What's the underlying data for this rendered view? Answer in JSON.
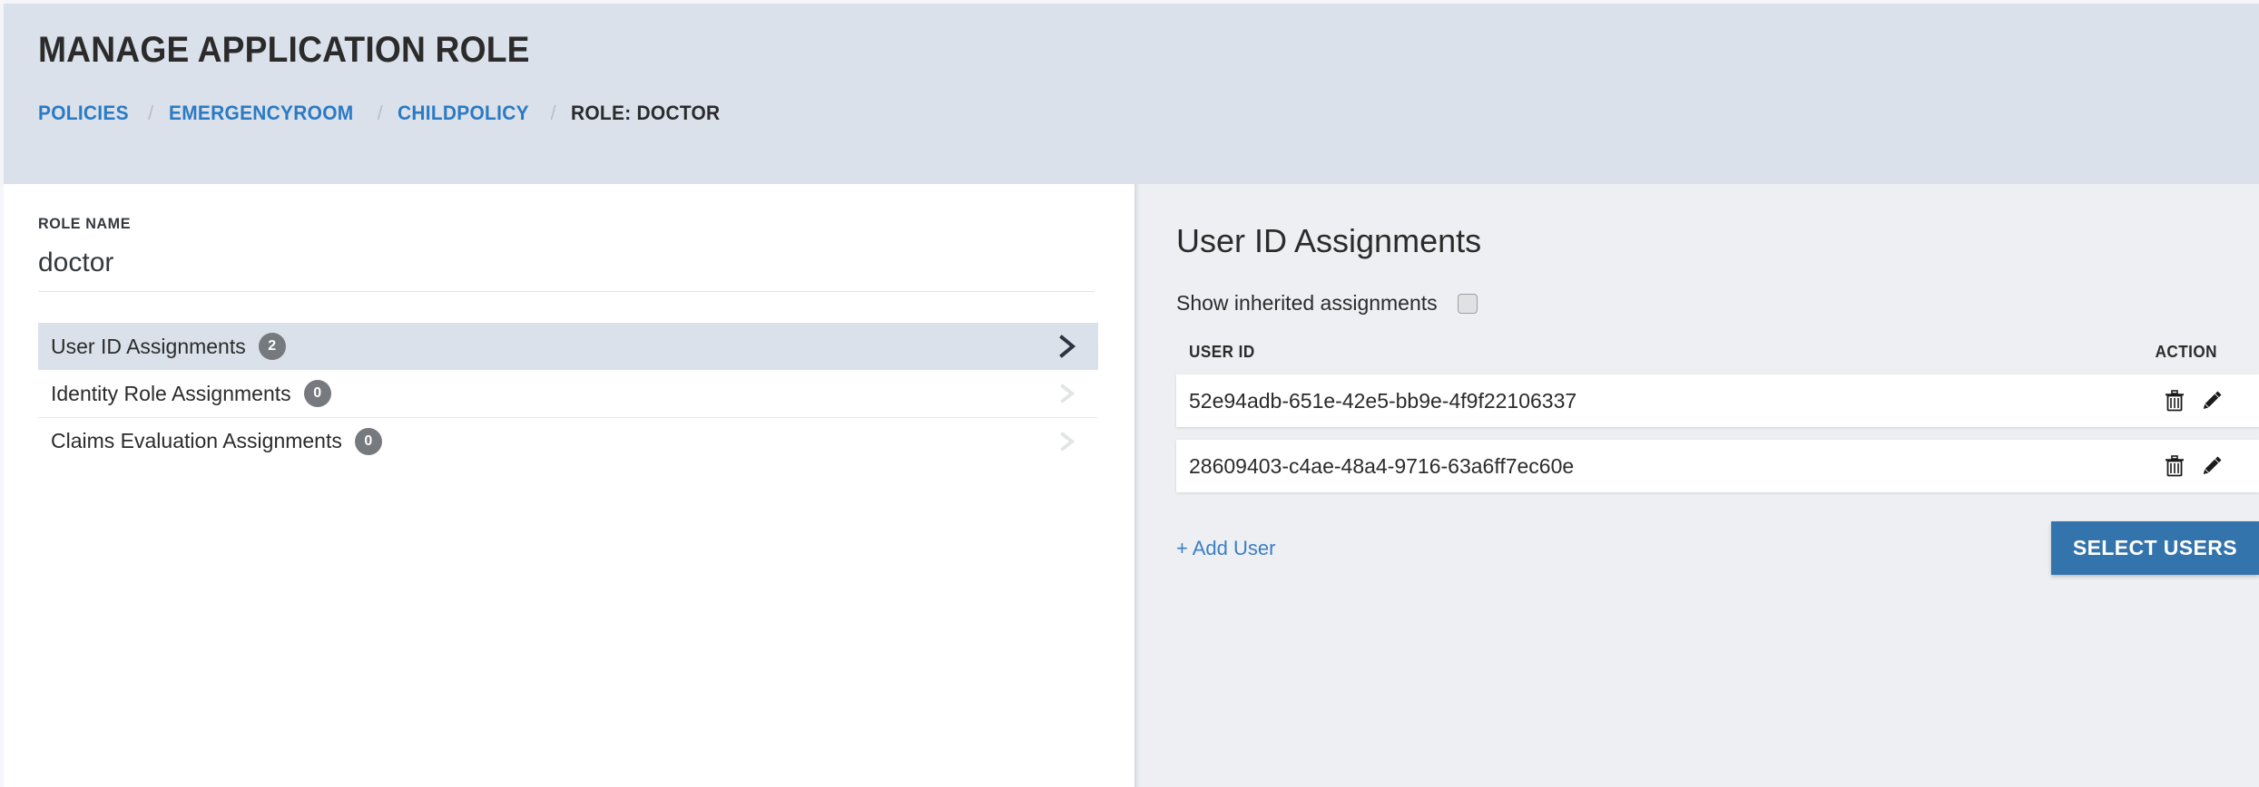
{
  "header": {
    "title": "MANAGE APPLICATION ROLE",
    "breadcrumb": [
      {
        "label": "POLICIES",
        "current": false
      },
      {
        "label": "EMERGENCYROOM",
        "current": false
      },
      {
        "label": "CHILDPOLICY",
        "current": false
      },
      {
        "label": "ROLE: DOCTOR",
        "current": true
      }
    ],
    "separator": "/",
    "bg_color": "#dbe1ea",
    "link_color": "#2a7ac4"
  },
  "left_pane": {
    "role_name_label": "ROLE NAME",
    "role_name_value": "doctor",
    "assignments": [
      {
        "label": "User ID Assignments",
        "count": "2",
        "active": true
      },
      {
        "label": "Identity Role Assignments",
        "count": "0",
        "active": false
      },
      {
        "label": "Claims Evaluation Assignments",
        "count": "0",
        "active": false
      }
    ]
  },
  "right_pane": {
    "panel_title": "User ID Assignments",
    "inherited_label": "Show inherited assignments",
    "inherited_checked": false,
    "columns": [
      "USER ID",
      "ACTION"
    ],
    "rows": [
      {
        "user_id": "52e94adb-651e-42e5-bb9e-4f9f22106337",
        "delete_icon": "trash-icon",
        "edit_icon": "pencil-icon"
      },
      {
        "user_id": "28609403-c4ae-48a4-9716-63a6ff7ec60e",
        "delete_icon": "trash-icon",
        "edit_icon": "pencil-icon"
      }
    ],
    "add_user_label": "+ Add User",
    "select_users_label": "SELECT USERS",
    "primary_button_color": "#3374ad",
    "panel_bg_color": "#edeff3"
  }
}
